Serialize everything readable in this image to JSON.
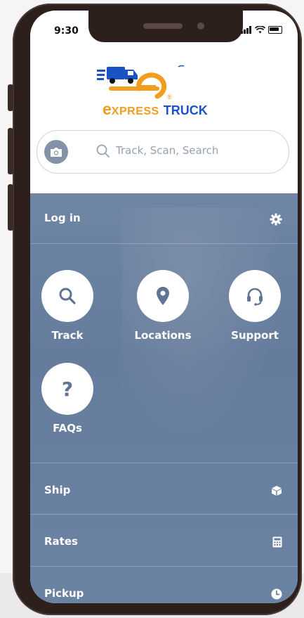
{
  "status_bar": {
    "time": "9:30",
    "signal": "📶",
    "wifi": "📡"
  },
  "brand": {
    "e_letter": "e",
    "name_part": "XPRESS",
    "name_main": "TRUCK",
    "trademark": "®"
  },
  "search": {
    "placeholder": "Track, Scan, Search"
  },
  "login_row": {
    "label": "Log in"
  },
  "quick_actions": [
    {
      "label": "Track"
    },
    {
      "label": "Locations"
    },
    {
      "label": "Support"
    },
    {
      "label": "FAQs"
    }
  ],
  "menu": [
    {
      "label": "Ship"
    },
    {
      "label": "Rates"
    },
    {
      "label": "Pickup"
    }
  ],
  "colors": {
    "panel": "#6a7f9f",
    "brand_orange": "#f29d1e",
    "brand_blue": "#1a53c6"
  }
}
